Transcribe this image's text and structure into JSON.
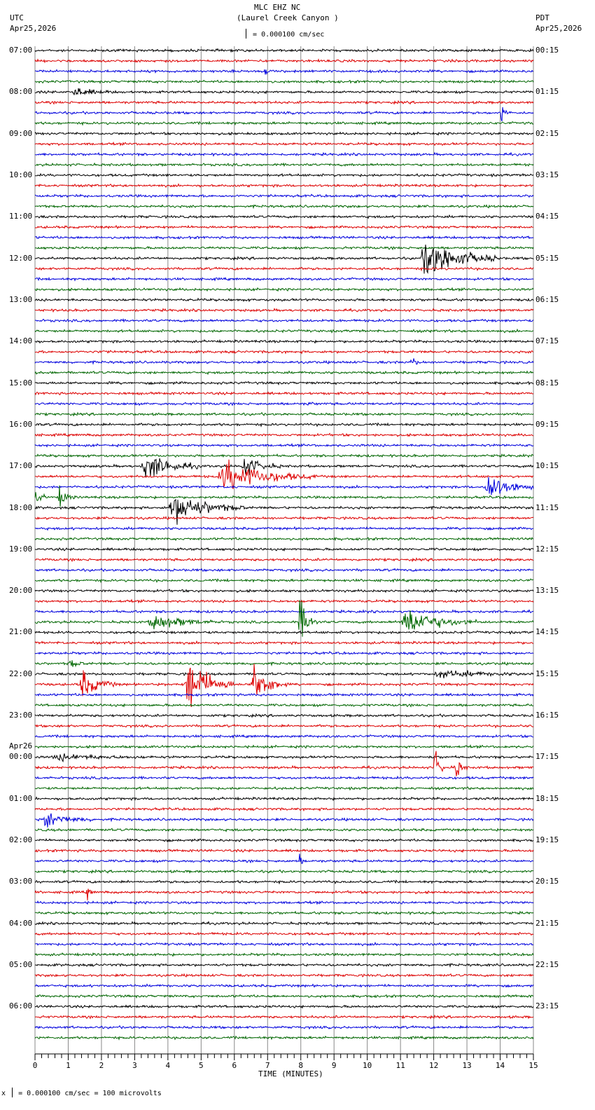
{
  "header": {
    "title": "MLC EHZ NC",
    "subtitle": "(Laurel Creek Canyon )",
    "left_tz": "UTC",
    "left_date": "Apr25,2026",
    "right_tz": "PDT",
    "right_date": "Apr25,2026",
    "scale": "= 0.000100 cm/sec"
  },
  "footer": {
    "prefix": "x",
    "scale": "= 0.000100 cm/sec =     100 microvolts"
  },
  "chart_data": {
    "type": "line",
    "subtype": "helicorder",
    "xlabel": "TIME (MINUTES)",
    "xlim": [
      0,
      15
    ],
    "x_ticks": [
      "0",
      "1",
      "2",
      "3",
      "4",
      "5",
      "6",
      "7",
      "8",
      "9",
      "10",
      "11",
      "12",
      "13",
      "14",
      "15"
    ],
    "trace_colors": [
      "#000000",
      "#dd0000",
      "#0000dd",
      "#006600"
    ],
    "trace_count": 96,
    "traces_per_hour": 4,
    "left_labels": [
      "07:00",
      "08:00",
      "09:00",
      "10:00",
      "11:00",
      "12:00",
      "13:00",
      "14:00",
      "15:00",
      "16:00",
      "17:00",
      "18:00",
      "19:00",
      "20:00",
      "21:00",
      "22:00",
      "23:00",
      "00:00",
      "01:00",
      "02:00",
      "03:00",
      "04:00",
      "05:00",
      "06:00"
    ],
    "date_change_label": "Apr26",
    "right_labels": [
      "00:15",
      "01:15",
      "02:15",
      "03:15",
      "04:15",
      "05:15",
      "06:15",
      "07:15",
      "08:15",
      "09:15",
      "10:15",
      "11:15",
      "12:15",
      "13:15",
      "14:15",
      "15:15",
      "16:15",
      "17:15",
      "18:15",
      "19:15",
      "20:15",
      "21:15",
      "22:15",
      "23:15"
    ],
    "events": [
      {
        "trace": 2,
        "start": 6.9,
        "end": 7.1,
        "amp": 6
      },
      {
        "trace": 4,
        "start": 1.1,
        "end": 2.4,
        "amp": 6
      },
      {
        "trace": 6,
        "start": 14.0,
        "end": 14.3,
        "amp": 14
      },
      {
        "trace": 20,
        "start": 11.6,
        "end": 14.0,
        "amp": 30
      },
      {
        "trace": 29,
        "start": 2.05,
        "end": 2.2,
        "amp": 5
      },
      {
        "trace": 30,
        "start": 11.3,
        "end": 11.6,
        "amp": 9
      },
      {
        "trace": 34,
        "start": 8.2,
        "end": 8.5,
        "amp": 3
      },
      {
        "trace": 40,
        "start": 3.2,
        "end": 5.0,
        "amp": 20
      },
      {
        "trace": 40,
        "start": 6.2,
        "end": 7.4,
        "amp": 14
      },
      {
        "trace": 41,
        "start": 5.5,
        "end": 8.5,
        "amp": 22
      },
      {
        "trace": 42,
        "start": 13.5,
        "end": 15.0,
        "amp": 20
      },
      {
        "trace": 43,
        "start": 0.0,
        "end": 0.4,
        "amp": 9
      },
      {
        "trace": 43,
        "start": 0.7,
        "end": 1.2,
        "amp": 15
      },
      {
        "trace": 44,
        "start": 4.0,
        "end": 6.4,
        "amp": 22
      },
      {
        "trace": 55,
        "start": 3.4,
        "end": 5.6,
        "amp": 11
      },
      {
        "trace": 55,
        "start": 7.9,
        "end": 8.6,
        "amp": 30
      },
      {
        "trace": 55,
        "start": 11.0,
        "end": 13.3,
        "amp": 20
      },
      {
        "trace": 59,
        "start": 1.0,
        "end": 1.6,
        "amp": 6
      },
      {
        "trace": 60,
        "start": 12.0,
        "end": 15.0,
        "amp": 5
      },
      {
        "trace": 61,
        "start": 1.3,
        "end": 2.5,
        "amp": 20
      },
      {
        "trace": 61,
        "start": 4.5,
        "end": 6.0,
        "amp": 40
      },
      {
        "trace": 61,
        "start": 6.5,
        "end": 7.6,
        "amp": 30
      },
      {
        "trace": 68,
        "start": 0.5,
        "end": 3.5,
        "amp": 4
      },
      {
        "trace": 69,
        "start": 12.0,
        "end": 12.4,
        "amp": 28
      },
      {
        "trace": 69,
        "start": 12.6,
        "end": 13.0,
        "amp": 20
      },
      {
        "trace": 74,
        "start": 0.2,
        "end": 1.8,
        "amp": 10
      },
      {
        "trace": 78,
        "start": 7.95,
        "end": 8.1,
        "amp": 10
      },
      {
        "trace": 81,
        "start": 1.55,
        "end": 1.75,
        "amp": 13
      }
    ]
  }
}
